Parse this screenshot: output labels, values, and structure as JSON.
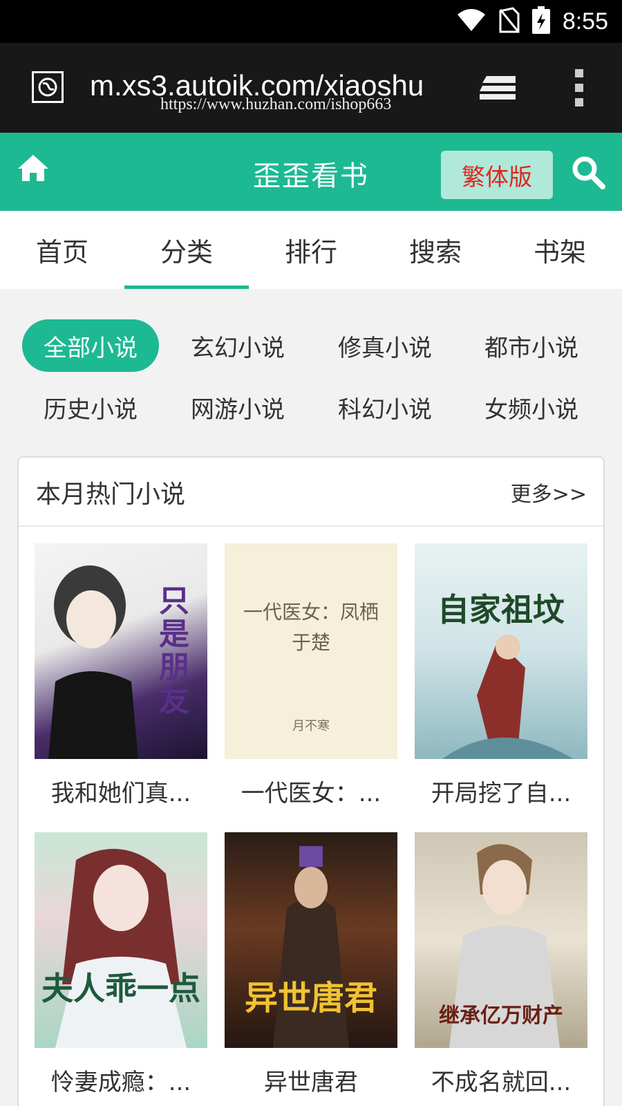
{
  "status_bar": {
    "time": "8:55"
  },
  "browser": {
    "url": "m.xs3.autoik.com/xiaoshu",
    "watermark": "https://www.huzhan.com/ishop663"
  },
  "header": {
    "title": "歪歪看书",
    "trad_button": "繁体版"
  },
  "nav": {
    "items": [
      {
        "label": "首页"
      },
      {
        "label": "分类"
      },
      {
        "label": "排行"
      },
      {
        "label": "搜索"
      },
      {
        "label": "书架"
      }
    ],
    "active_index": 1
  },
  "categories": [
    {
      "label": "全部小说"
    },
    {
      "label": "玄幻小说"
    },
    {
      "label": "修真小说"
    },
    {
      "label": "都市小说"
    },
    {
      "label": "历史小说"
    },
    {
      "label": "网游小说"
    },
    {
      "label": "科幻小说"
    },
    {
      "label": "女频小说"
    }
  ],
  "hot": {
    "title": "本月热门小说",
    "more": "更多>>",
    "books": [
      {
        "title": "我和她们真...",
        "cover_text": "只是朋友"
      },
      {
        "title": "一代医女：...",
        "cover_text": "一代医女：凤栖于楚",
        "cover_author": "月不寒"
      },
      {
        "title": "开局挖了自...",
        "cover_text": "自家祖坟"
      },
      {
        "title": "怜妻成瘾：...",
        "cover_text": "夫人乖一点"
      },
      {
        "title": "异世唐君",
        "cover_text": "异世唐君"
      },
      {
        "title": "不成名就回...",
        "cover_text": "继承亿万财产"
      }
    ]
  },
  "colors": {
    "accent": "#1db992",
    "trad_text": "#e0281e"
  }
}
